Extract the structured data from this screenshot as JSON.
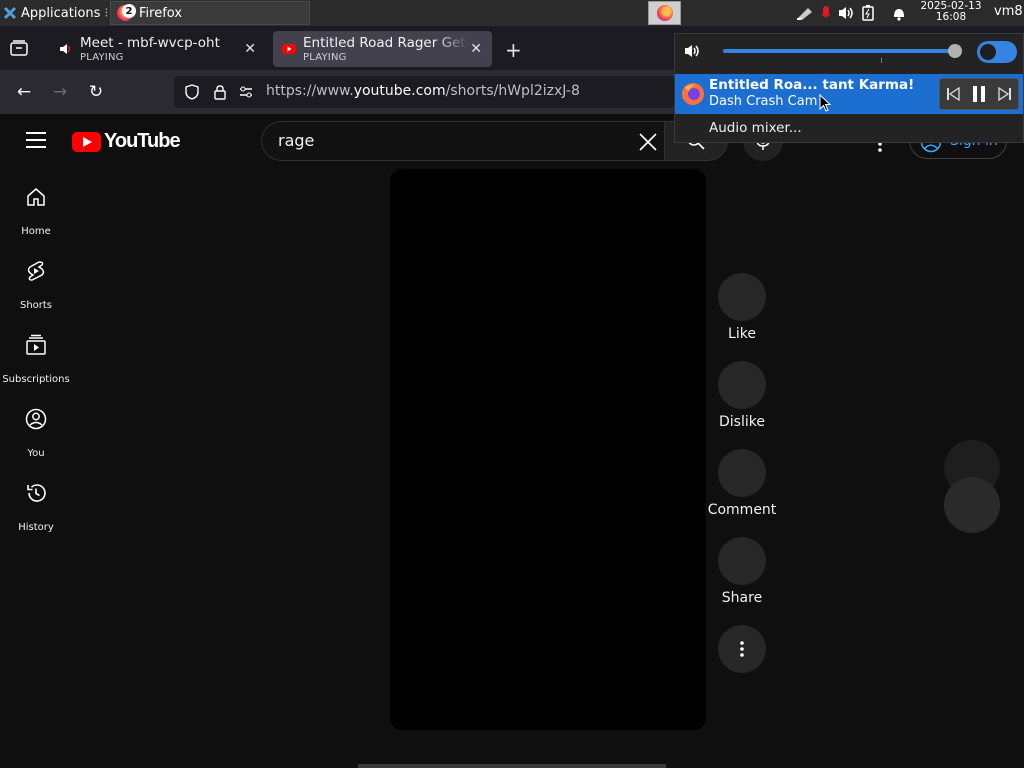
{
  "panel": {
    "applications_label": "Applications",
    "task_title": "Firefox",
    "task_badge": "2",
    "clock_date": "2025-02-13",
    "clock_time": "16:08",
    "user": "vm8"
  },
  "tabs": [
    {
      "title": "Meet - mbf-wvcp-oht",
      "status": "PLAYING",
      "active": false
    },
    {
      "title": "Entitled Road Rager Gets",
      "status": "PLAYING",
      "active": true
    }
  ],
  "urlbar": {
    "url_prefix": "https://www.",
    "url_host": "youtube.com",
    "url_path": "/shorts/hWpl2izxJ-8"
  },
  "youtube": {
    "logo_text": "YouTube",
    "search_query": "rage",
    "sign_in": "Sign in",
    "guide": [
      {
        "label": "Home",
        "icon": "home-icon"
      },
      {
        "label": "Shorts",
        "icon": "shorts-icon"
      },
      {
        "label": "Subscriptions",
        "icon": "subscriptions-icon"
      },
      {
        "label": "You",
        "icon": "you-icon"
      },
      {
        "label": "History",
        "icon": "history-icon"
      }
    ],
    "actions": [
      {
        "label": "Like"
      },
      {
        "label": "Dislike"
      },
      {
        "label": "Comment"
      },
      {
        "label": "Share"
      }
    ]
  },
  "media_popup": {
    "volume_level": 0.96,
    "volume_enabled": true,
    "now_playing_title": "Entitled Roa... tant Karma!",
    "now_playing_artist": "Dash Crash Cam",
    "audio_mixer": "Audio mixer..."
  },
  "colors": {
    "yt_red": "#ff0000",
    "accent_blue": "#3584e4",
    "media_highlight": "#1c6fd1",
    "signin_blue": "#3ea6ff"
  }
}
